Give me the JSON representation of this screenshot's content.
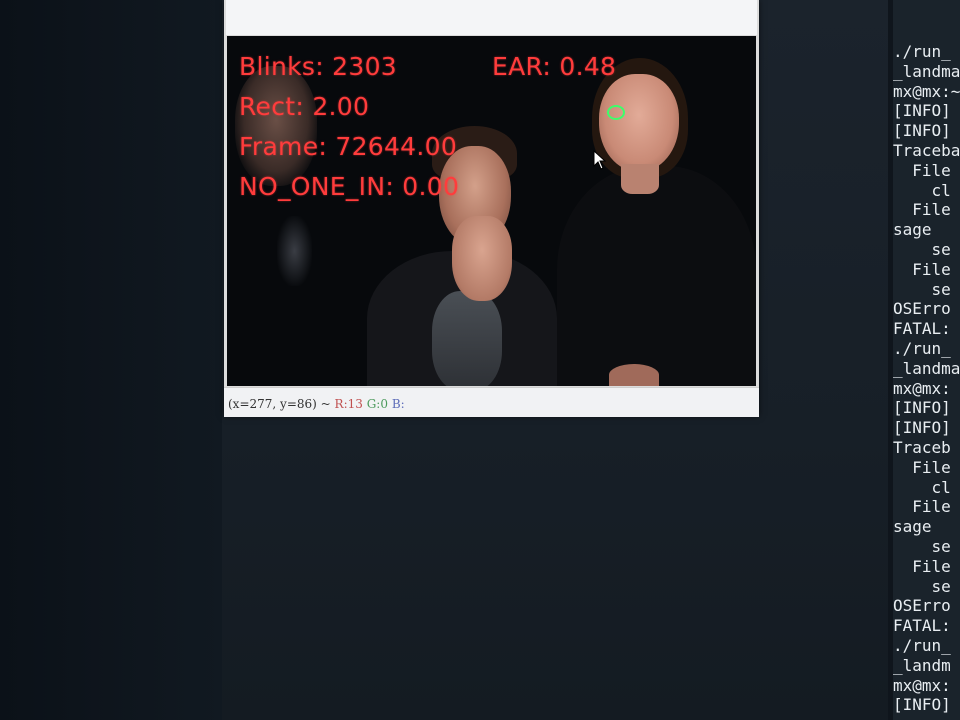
{
  "viewer": {
    "overlay": {
      "blinks": "Blinks: 2303",
      "ear": "EAR: 0.48",
      "rect": "Rect: 2.00",
      "frame": "Frame: 72644.00",
      "no_one_in": "NO_ONE_IN: 0.00"
    },
    "status": {
      "coords": "(x=277, y=86) ~",
      "r": "R:13",
      "g": "G:0",
      "b": "B:"
    }
  },
  "terminal": {
    "lines": [
      "./run_",
      "_landma",
      "mx@mx:~",
      "[INFO]",
      "[INFO]",
      "Traceba",
      "  File",
      "    cl",
      "  File",
      "sage",
      "    se",
      "  File",
      "    se",
      "OSErro",
      "FATAL:",
      "./run_",
      "_landma",
      "mx@mx:",
      "[INFO]",
      "[INFO]",
      "Traceb",
      "  File",
      "    cl",
      "  File",
      "sage",
      "    se",
      "  File",
      "    se",
      "OSErro",
      "FATAL:",
      "./run_",
      "_landm",
      "mx@mx:",
      "[INFO]"
    ]
  },
  "colors": {
    "overlay_text": "#ff3c3c",
    "eye_marker": "#3bff6a",
    "terminal_bg": "#1a232b",
    "terminal_text": "#e9eef2"
  }
}
